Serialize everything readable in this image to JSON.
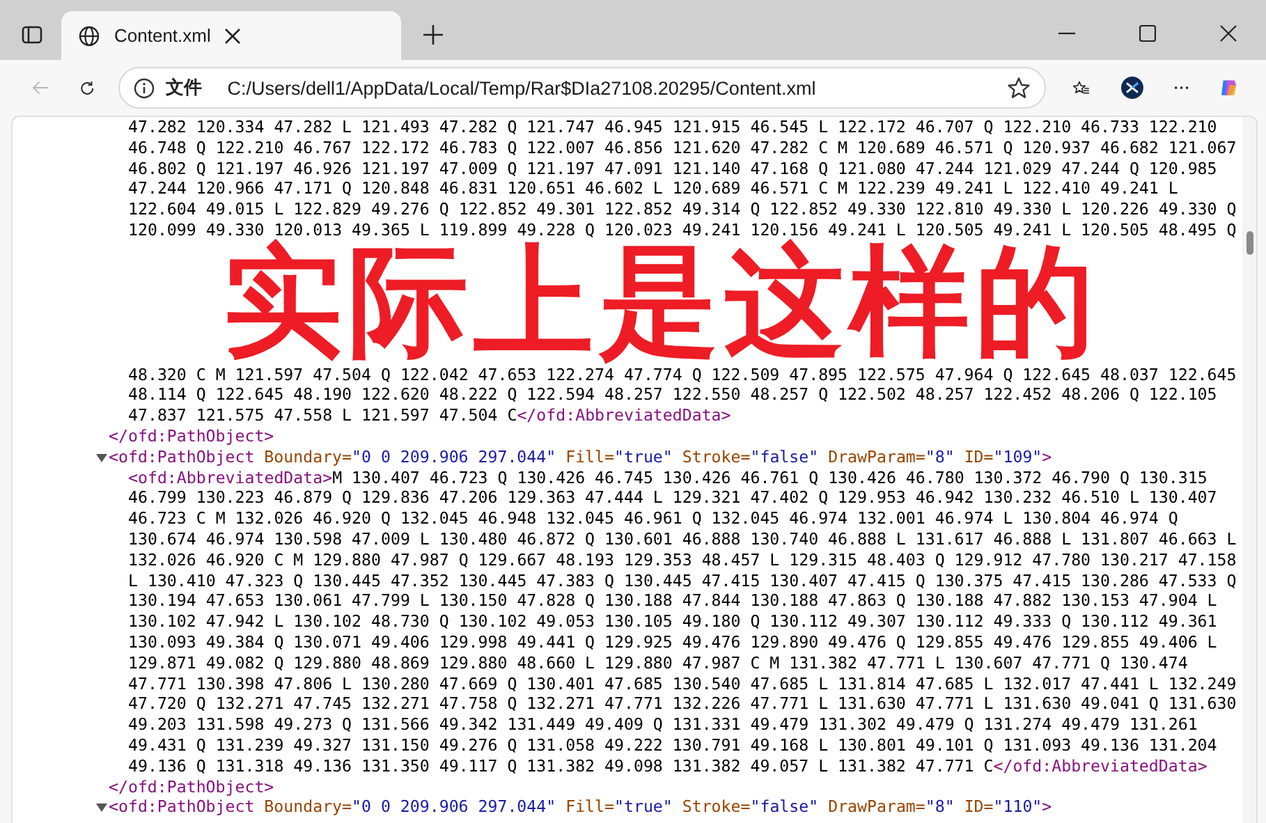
{
  "browser": {
    "tab": {
      "title": "Content.xml",
      "selected": true
    },
    "back_disabled": true,
    "address": {
      "scheme_label": "文件",
      "url": "C:/Users/dell1/AppData/Local/Temp/Rar$DIa27108.20295/Content.xml"
    }
  },
  "document": {
    "elements": [
      {
        "children": [
          {
            "kind": "lines",
            "lines": [
              [
                {
                  "kind": "text",
                  "text": "47.282 120.334 47.282 L 121.493 47.282 Q 121.747 46.945 121.915 46.545 L 122.172 46.707 Q 122.210 46.733 122.210"
                }
              ],
              [
                {
                  "kind": "text",
                  "text": "46.748 Q 122.210 46.767 122.172 46.783 Q 122.007 46.856 121.620 47.282 C M 120.689 46.571 Q 120.937 46.682 121.067"
                }
              ],
              [
                {
                  "kind": "text",
                  "text": "46.802 Q 121.197 46.926 121.197 47.009 Q 121.197 47.091 121.140 47.168 Q 121.080 47.244 121.029 47.244 Q 120.985"
                }
              ],
              [
                {
                  "kind": "text",
                  "text": "47.244 120.966 47.171 Q 120.848 46.831 120.651 46.602 L 120.689 46.571 C M 122.239 49.241 L 122.410 49.241 L"
                }
              ],
              [
                {
                  "kind": "text",
                  "text": "122.604 49.015 L 122.829 49.276 Q 122.852 49.301 122.852 49.314 Q 122.852 49.330 122.810 49.330 L 120.226 49.330 Q"
                }
              ],
              [
                {
                  "kind": "text",
                  "text": "120.099 49.330 120.013 49.365 L 119.899 49.228 Q 120.023 49.241 120.156 49.241 L 120.505 49.241 L 120.505 48.495 Q"
                }
              ]
            ]
          },
          {
            "kind": "annotation",
            "text": "实际上是这样的"
          },
          {
            "kind": "lines",
            "lines": [
              [
                {
                  "kind": "text",
                  "text": "48.320 C M 121.597 47.504 Q 122.042 47.653 122.274 47.774 Q 122.509 47.895 122.575 47.964 Q 122.645 48.037 122.645"
                }
              ],
              [
                {
                  "kind": "text",
                  "text": "48.114 Q 122.645 48.190 122.620 48.222 Q 122.594 48.257 122.550 48.257 Q 122.502 48.257 122.452 48.206 Q 122.105"
                }
              ],
              [
                {
                  "kind": "text",
                  "text": "47.837 121.575 47.558 L 121.597 47.504 C"
                },
                {
                  "kind": "tag",
                  "text": "</ofd:AbbreviatedData>"
                }
              ]
            ]
          }
        ],
        "close": [
          {
            "kind": "tag",
            "text": "</ofd:PathObject>"
          }
        ]
      },
      {
        "expanded": true,
        "open": [
          {
            "kind": "tag",
            "text": "<ofd:PathObject"
          },
          {
            "kind": "attr",
            "text": " Boundary="
          },
          {
            "kind": "value",
            "text": "\"0 0 209.906 297.044\""
          },
          {
            "kind": "attr",
            "text": " Fill="
          },
          {
            "kind": "value",
            "text": "\"true\""
          },
          {
            "kind": "attr",
            "text": " Stroke="
          },
          {
            "kind": "value",
            "text": "\"false\""
          },
          {
            "kind": "attr",
            "text": " DrawParam="
          },
          {
            "kind": "value",
            "text": "\"8\""
          },
          {
            "kind": "attr",
            "text": " ID="
          },
          {
            "kind": "value",
            "text": "\"109\""
          },
          {
            "kind": "tag",
            "text": ">"
          }
        ],
        "children": [
          {
            "kind": "lines",
            "lines": [
              [
                {
                  "kind": "tag",
                  "text": "<ofd:AbbreviatedData>"
                },
                {
                  "kind": "text",
                  "text": "M 130.407 46.723 Q 130.426 46.745 130.426 46.761 Q 130.426 46.780 130.372 46.790 Q 130.315"
                }
              ],
              [
                {
                  "kind": "text",
                  "text": "46.799 130.223 46.879 Q 129.836 47.206 129.363 47.444 L 129.321 47.402 Q 129.953 46.942 130.232 46.510 L 130.407"
                }
              ],
              [
                {
                  "kind": "text",
                  "text": "46.723 C M 132.026 46.920 Q 132.045 46.948 132.045 46.961 Q 132.045 46.974 132.001 46.974 L 130.804 46.974 Q"
                }
              ],
              [
                {
                  "kind": "text",
                  "text": "130.674 46.974 130.598 47.009 L 130.480 46.872 Q 130.601 46.888 130.740 46.888 L 131.617 46.888 L 131.807 46.663 L"
                }
              ],
              [
                {
                  "kind": "text",
                  "text": "132.026 46.920 C M 129.880 47.987 Q 129.667 48.193 129.353 48.457 L 129.315 48.403 Q 129.912 47.780 130.217 47.158"
                }
              ],
              [
                {
                  "kind": "text",
                  "text": "L 130.410 47.323 Q 130.445 47.352 130.445 47.383 Q 130.445 47.415 130.407 47.415 Q 130.375 47.415 130.286 47.533 Q"
                }
              ],
              [
                {
                  "kind": "text",
                  "text": "130.194 47.653 130.061 47.799 L 130.150 47.828 Q 130.188 47.844 130.188 47.863 Q 130.188 47.882 130.153 47.904 L"
                }
              ],
              [
                {
                  "kind": "text",
                  "text": "130.102 47.942 L 130.102 48.730 Q 130.102 49.053 130.105 49.180 Q 130.112 49.307 130.112 49.333 Q 130.112 49.361"
                }
              ],
              [
                {
                  "kind": "text",
                  "text": "130.093 49.384 Q 130.071 49.406 129.998 49.441 Q 129.925 49.476 129.890 49.476 Q 129.855 49.476 129.855 49.406 L"
                }
              ],
              [
                {
                  "kind": "text",
                  "text": "129.871 49.082 Q 129.880 48.869 129.880 48.660 L 129.880 47.987 C M 131.382 47.771 L 130.607 47.771 Q 130.474"
                }
              ],
              [
                {
                  "kind": "text",
                  "text": "47.771 130.398 47.806 L 130.280 47.669 Q 130.401 47.685 130.540 47.685 L 131.814 47.685 L 132.017 47.441 L 132.249"
                }
              ],
              [
                {
                  "kind": "text",
                  "text": "47.720 Q 132.271 47.745 132.271 47.758 Q 132.271 47.771 132.226 47.771 L 131.630 47.771 L 131.630 49.041 Q 131.630"
                }
              ],
              [
                {
                  "kind": "text",
                  "text": "49.203 131.598 49.273 Q 131.566 49.342 131.449 49.409 Q 131.331 49.479 131.302 49.479 Q 131.274 49.479 131.261"
                }
              ],
              [
                {
                  "kind": "text",
                  "text": "49.431 Q 131.239 49.327 131.150 49.276 Q 131.058 49.222 130.791 49.168 L 130.801 49.101 Q 131.093 49.136 131.204"
                }
              ],
              [
                {
                  "kind": "text",
                  "text": "49.136 Q 131.318 49.136 131.350 49.117 Q 131.382 49.098 131.382 49.057 L 131.382 47.771 C"
                },
                {
                  "kind": "tag",
                  "text": "</ofd:AbbreviatedData>"
                }
              ]
            ]
          }
        ],
        "close": [
          {
            "kind": "tag",
            "text": "</ofd:PathObject>"
          }
        ]
      },
      {
        "expanded": true,
        "open": [
          {
            "kind": "tag",
            "text": "<ofd:PathObject"
          },
          {
            "kind": "attr",
            "text": " Boundary="
          },
          {
            "kind": "value",
            "text": "\"0 0 209.906 297.044\""
          },
          {
            "kind": "attr",
            "text": " Fill="
          },
          {
            "kind": "value",
            "text": "\"true\""
          },
          {
            "kind": "attr",
            "text": " Stroke="
          },
          {
            "kind": "value",
            "text": "\"false\""
          },
          {
            "kind": "attr",
            "text": " DrawParam="
          },
          {
            "kind": "value",
            "text": "\"8\""
          },
          {
            "kind": "attr",
            "text": " ID="
          },
          {
            "kind": "value",
            "text": "\"110\""
          },
          {
            "kind": "tag",
            "text": ">"
          }
        ]
      }
    ]
  }
}
